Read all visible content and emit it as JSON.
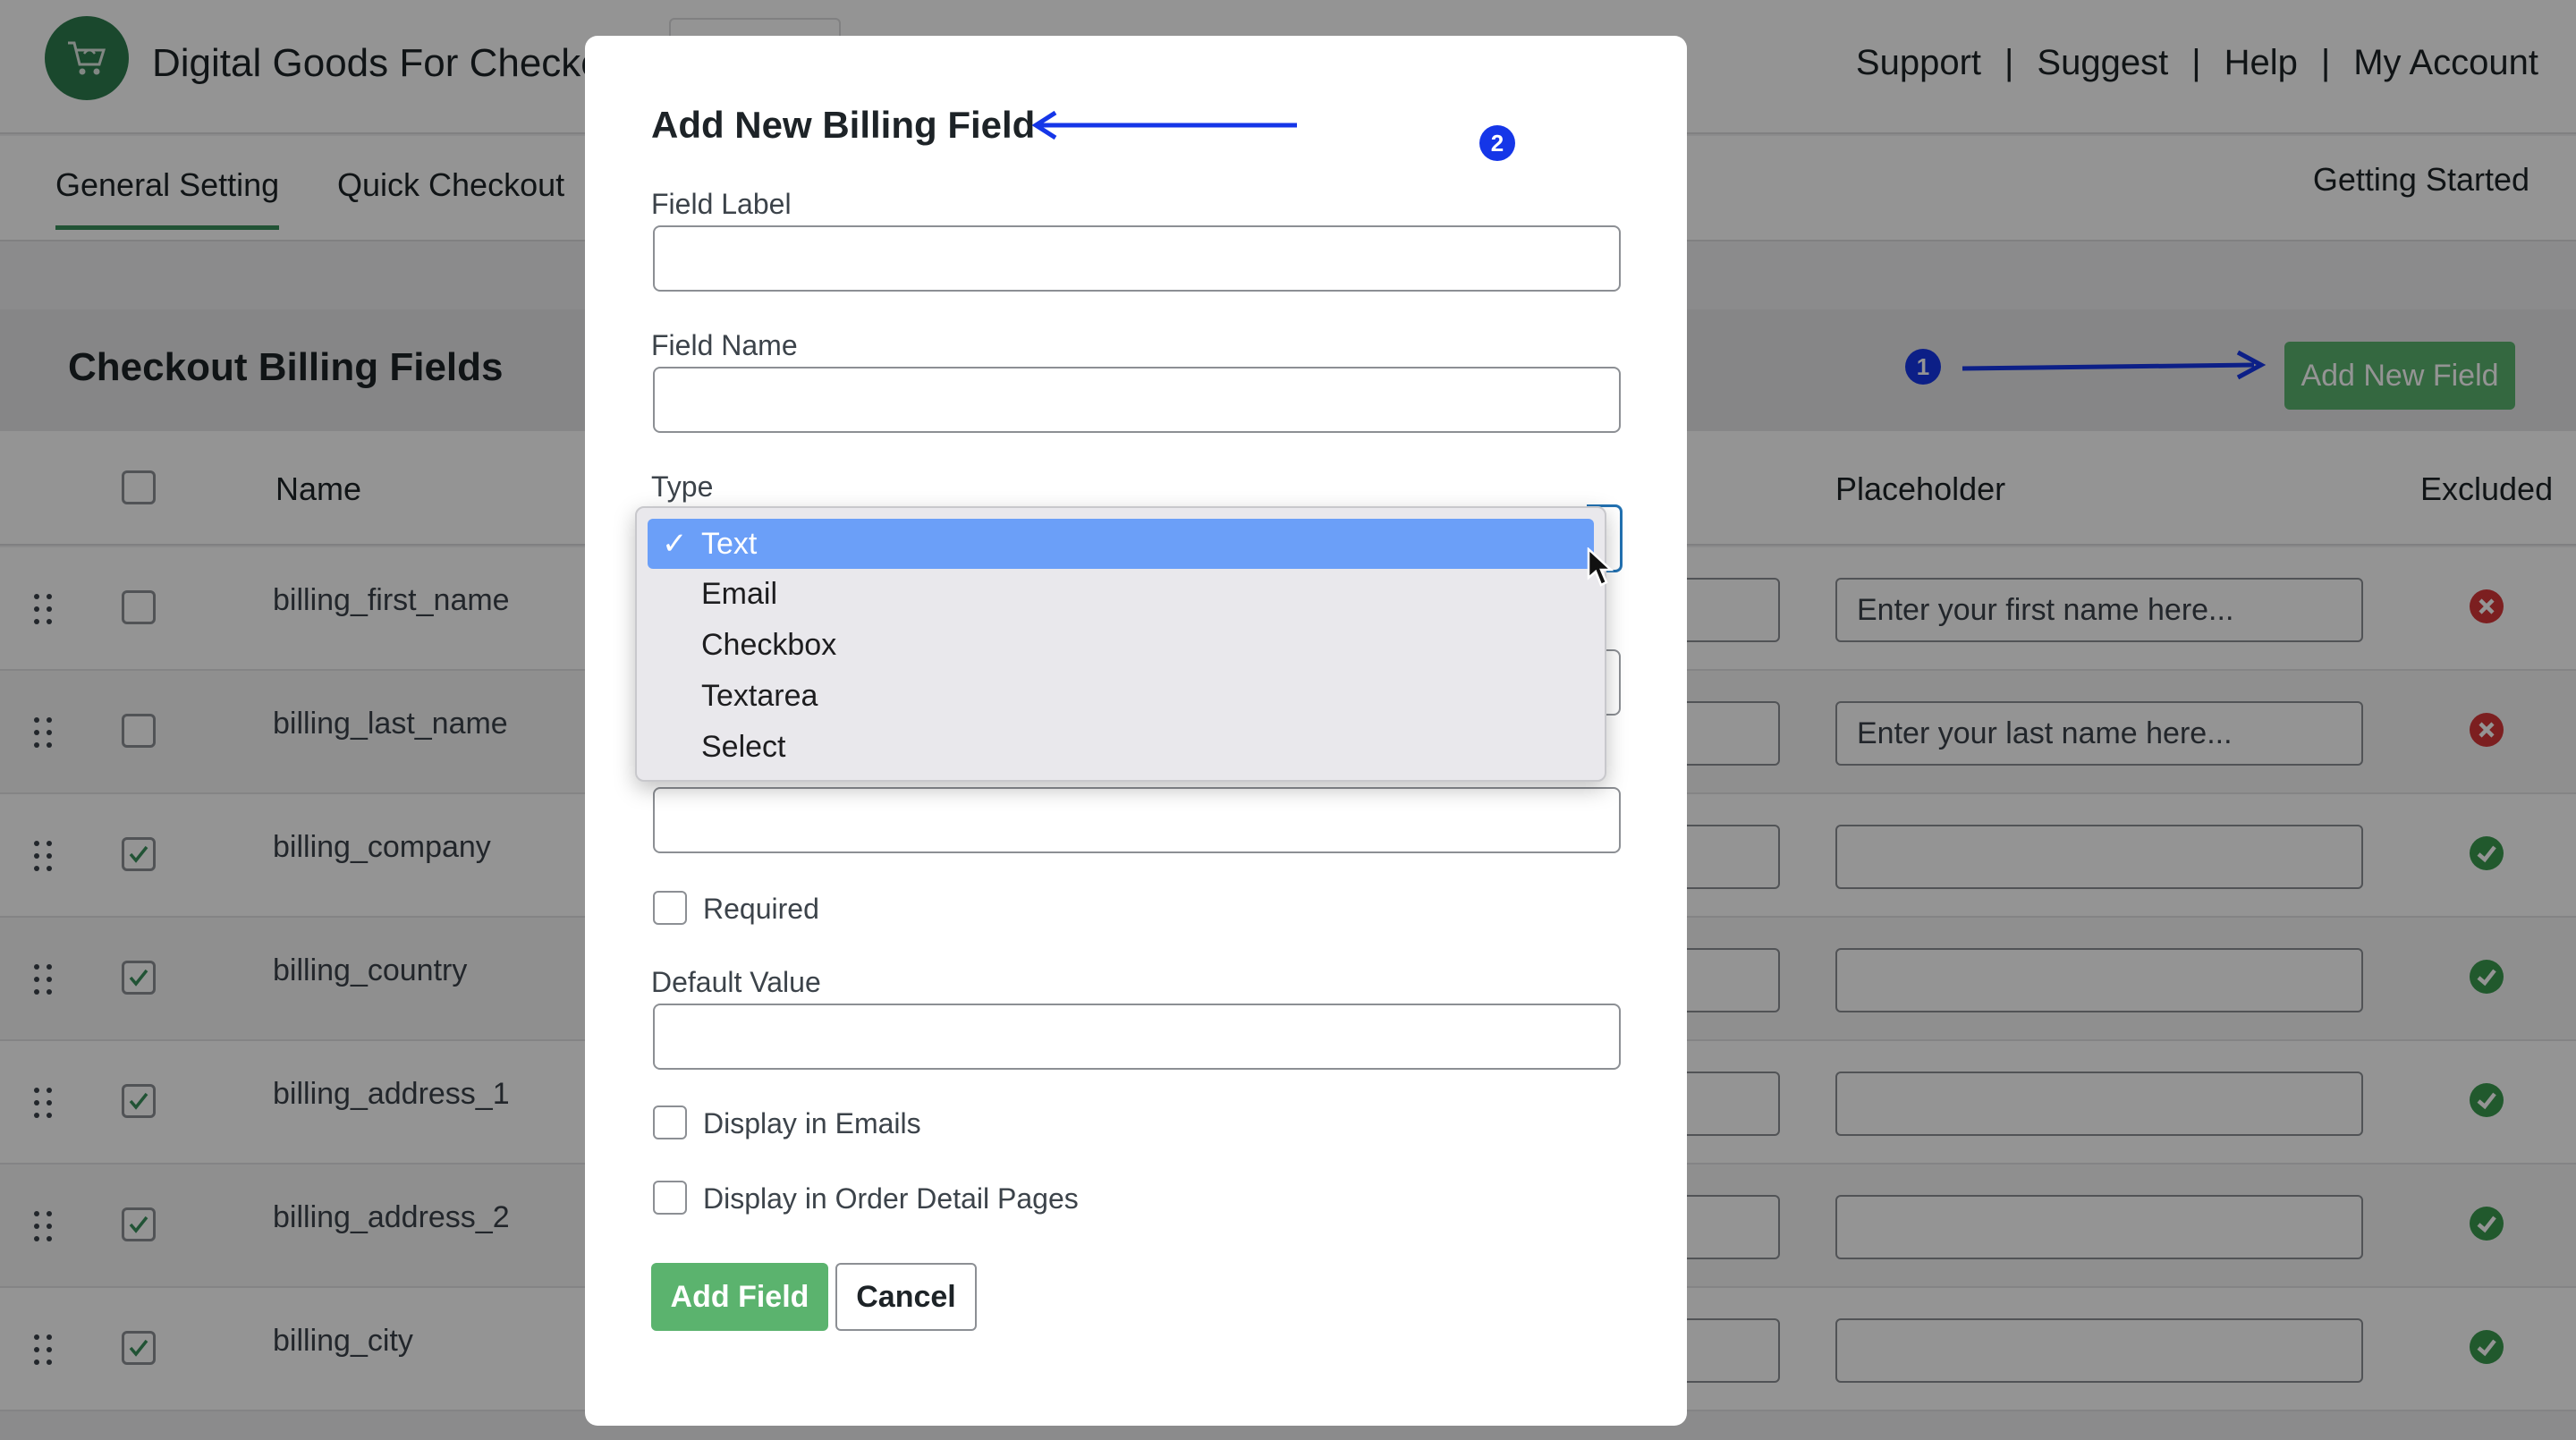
{
  "app": {
    "title": "Digital Goods For Checkout"
  },
  "top_links": [
    "Support",
    "Suggest",
    "Help",
    "My Account"
  ],
  "link_separator": "|",
  "nav": {
    "tabs": [
      "General Setting",
      "Quick Checkout"
    ],
    "getting_started": "Getting Started"
  },
  "fields_section": {
    "title": "Checkout Billing Fields",
    "add_button": "Add New Field"
  },
  "table": {
    "columns": {
      "name": "Name",
      "placeholder": "Placeholder",
      "excluded": "Excluded"
    },
    "rows": [
      {
        "name": "billing_first_name",
        "checked": false,
        "placeholder": "Enter your first name here...",
        "excluded": true
      },
      {
        "name": "billing_last_name",
        "checked": false,
        "placeholder": "Enter your last name here...",
        "excluded": true
      },
      {
        "name": "billing_company",
        "checked": true,
        "placeholder": "",
        "excluded": false
      },
      {
        "name": "billing_country",
        "checked": true,
        "placeholder": "",
        "excluded": false
      },
      {
        "name": "billing_address_1",
        "checked": true,
        "placeholder": "",
        "excluded": false
      },
      {
        "name": "billing_address_2",
        "checked": true,
        "placeholder": "",
        "excluded": false
      },
      {
        "name": "billing_city",
        "checked": true,
        "placeholder": "",
        "excluded": false
      }
    ]
  },
  "annotations": {
    "step1": "1",
    "step2": "2"
  },
  "modal": {
    "title": "Add New Billing Field",
    "field_label": "Field Label",
    "field_name": "Field Name",
    "type_label": "Type",
    "type_options": [
      "Text",
      "Email",
      "Checkbox",
      "Textarea",
      "Select"
    ],
    "type_selected": "Text",
    "check_mark": "✓",
    "required": "Required",
    "default_value": "Default Value",
    "display_emails": "Display in Emails",
    "display_order": "Display in Order Detail Pages",
    "add_button": "Add Field",
    "cancel_button": "Cancel"
  },
  "colors": {
    "accent_green": "#5bb36e",
    "annotation_blue": "#1536e8",
    "selected_option": "#6b9ff8",
    "excluded_red": "#d63638",
    "included_green": "#3a9a4f"
  },
  "icons": {
    "logo": "shopping-cart-icon",
    "drag": "drag-handle-icon",
    "excluded": "x-circle-icon",
    "included": "check-circle-icon"
  }
}
